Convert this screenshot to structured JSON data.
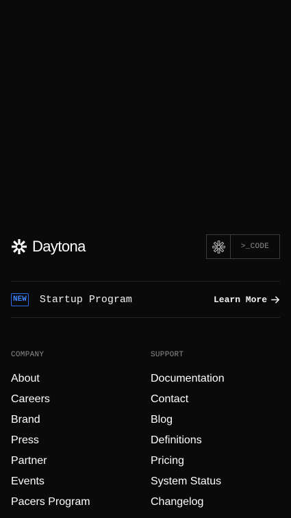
{
  "brand": {
    "name": "Daytona",
    "logo_icon": "daytona-burst-icon"
  },
  "code_button": {
    "icon": "daytona-burst-icon",
    "label": ">_CODE"
  },
  "promo": {
    "badge": "NEW",
    "title": "Startup Program",
    "link_label": "Learn More",
    "link_icon": "arrow-right-icon",
    "accent_color": "#2f6df0"
  },
  "footer": {
    "company": {
      "heading": "COMPANY",
      "items": [
        "About",
        "Careers",
        "Brand",
        "Press",
        "Partner",
        "Events",
        "Pacers Program"
      ]
    },
    "support": {
      "heading": "SUPPORT",
      "items": [
        "Documentation",
        "Contact",
        "Blog",
        "Definitions",
        "Pricing",
        "System Status",
        "Changelog"
      ]
    }
  }
}
